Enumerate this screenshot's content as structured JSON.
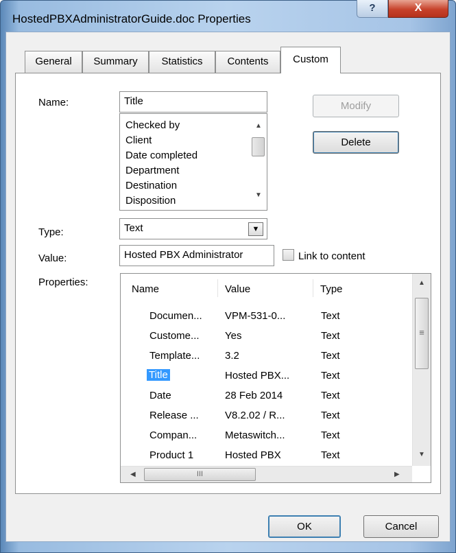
{
  "window": {
    "title": "HostedPBXAdministratorGuide.doc Properties",
    "help_glyph": "?",
    "close_glyph": "X"
  },
  "tabs": [
    {
      "label": "General"
    },
    {
      "label": "Summary"
    },
    {
      "label": "Statistics"
    },
    {
      "label": "Contents"
    },
    {
      "label": "Custom",
      "active": true
    }
  ],
  "custom": {
    "name_label": "Name:",
    "name_value": "Title",
    "name_options": [
      "Checked by",
      "Client",
      "Date completed",
      "Department",
      "Destination",
      "Disposition"
    ],
    "modify_label": "Modify",
    "delete_label": "Delete",
    "type_label": "Type:",
    "type_value": "Text",
    "value_label": "Value:",
    "value_text": "Hosted PBX Administrator",
    "link_label": "Link to content",
    "link_checked": false,
    "properties_label": "Properties:"
  },
  "properties_table": {
    "headers": [
      "Name",
      "Value",
      "Type"
    ],
    "rows": [
      {
        "name": "Documen...",
        "value": "VPM-531-0...",
        "type": "Text"
      },
      {
        "name": "Custome...",
        "value": "Yes",
        "type": "Text"
      },
      {
        "name": "Template...",
        "value": "3.2",
        "type": "Text"
      },
      {
        "name": "Title",
        "value": "Hosted PBX...",
        "type": "Text",
        "selected": true
      },
      {
        "name": "Date",
        "value": "28 Feb 2014",
        "type": "Text"
      },
      {
        "name": "Release ...",
        "value": "V8.2.02 / R...",
        "type": "Text"
      },
      {
        "name": "Compan...",
        "value": "Metaswitch...",
        "type": "Text"
      },
      {
        "name": "Product 1",
        "value": "Hosted PBX",
        "type": "Text"
      }
    ],
    "hscroll_grip": "III",
    "vscroll_grip": "≡"
  },
  "footer": {
    "ok_label": "OK",
    "cancel_label": "Cancel"
  }
}
